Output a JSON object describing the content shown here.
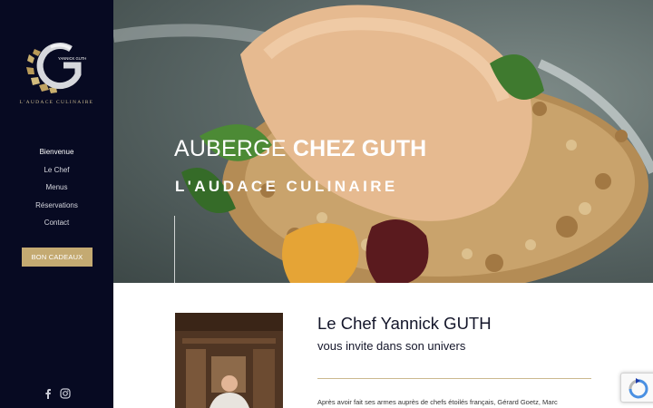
{
  "brand": {
    "logo_text": "YANNICK GUTH",
    "tagline": "L'AUDACE CULINAIRE",
    "accent_color": "#c4aa72",
    "sidebar_color": "#070a22"
  },
  "nav": {
    "items": [
      {
        "label": "Bienvenue",
        "active": true
      },
      {
        "label": "Le Chef"
      },
      {
        "label": "Menus"
      },
      {
        "label": "Réservations"
      },
      {
        "label": "Contact"
      }
    ]
  },
  "gift_button": {
    "label": "BON CADEAUX"
  },
  "social": {
    "icons": [
      "facebook-icon",
      "instagram-icon"
    ]
  },
  "hero": {
    "title_light": "AUBERGE ",
    "title_bold": "CHEZ GUTH",
    "subtitle": "L'AUDACE CULINAIRE"
  },
  "content": {
    "title": "Le Chef Yannick GUTH",
    "subtitle": "vous invite dans son univers",
    "paragraph": "Après avoir fait ses armes auprès de chefs étoilés français, Gérard Goetz, Marc"
  }
}
